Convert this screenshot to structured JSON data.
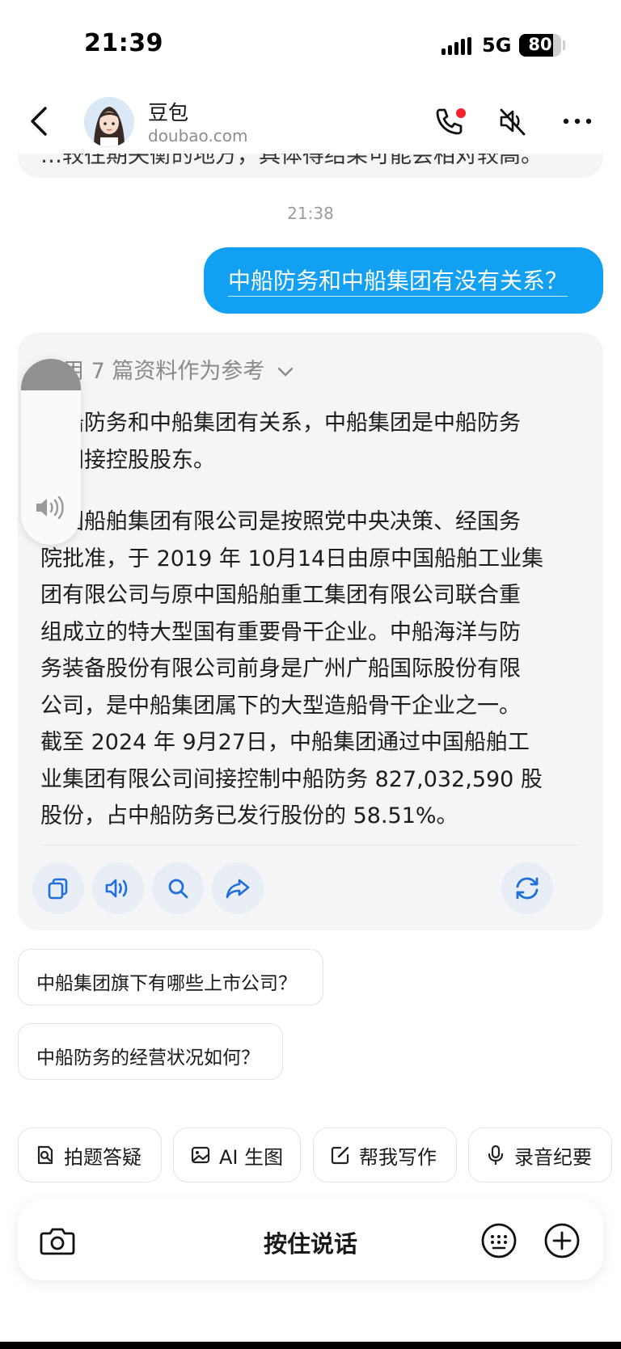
{
  "status": {
    "time": "21:39",
    "network": "5G",
    "battery": "80",
    "battery_level": 0.8
  },
  "header": {
    "name": "豆包",
    "domain": "doubao.com"
  },
  "prev_message": {
    "fragment": "…较往期失衡的地方，具体得结果可能会相对较高。"
  },
  "timestamp": "21:38",
  "user_message": "中船防务和中船集团有没有关系？",
  "answer": {
    "refs": "引用 7 篇资料作为参考",
    "para1_lines": [
      "中船防务和中船集团有关系，中船集团是中船防务",
      "的间接控股股东。"
    ],
    "para2_lines": [
      "中国船舶集团有限公司是按照党中央决策、经国务",
      "院批准，于 2019 年 10月14日由原中国船舶工业集",
      "团有限公司与原中国船舶重工集团有限公司联合重",
      "组成立的特大型国有重要骨干企业。中船海洋与防",
      "务装备股份有限公司前身是广州广船国际股份有限",
      "公司，是中船集团属下的大型造船骨干企业之一。",
      "截至 2024 年 9月27日，中船集团通过中国船舶工",
      "业集团有限公司间接控制中船防务 827,032,590 股",
      "股份，占中船防务已发行股份的 58.51%。"
    ]
  },
  "volume": {
    "level": 0.17
  },
  "suggestions": [
    "中船集团旗下有哪些上市公司？",
    "中船防务的经营状况如何？"
  ],
  "tools": [
    "拍题答疑",
    "AI 生图",
    "帮我写作",
    "录音纪要"
  ],
  "input": {
    "hold_to_talk": "按住说话"
  },
  "colors": {
    "accent": "#11a0f2",
    "card_bg": "#f4f5f7",
    "action_bg": "#e8edf6",
    "icon_blue": "#1e6fdc"
  }
}
